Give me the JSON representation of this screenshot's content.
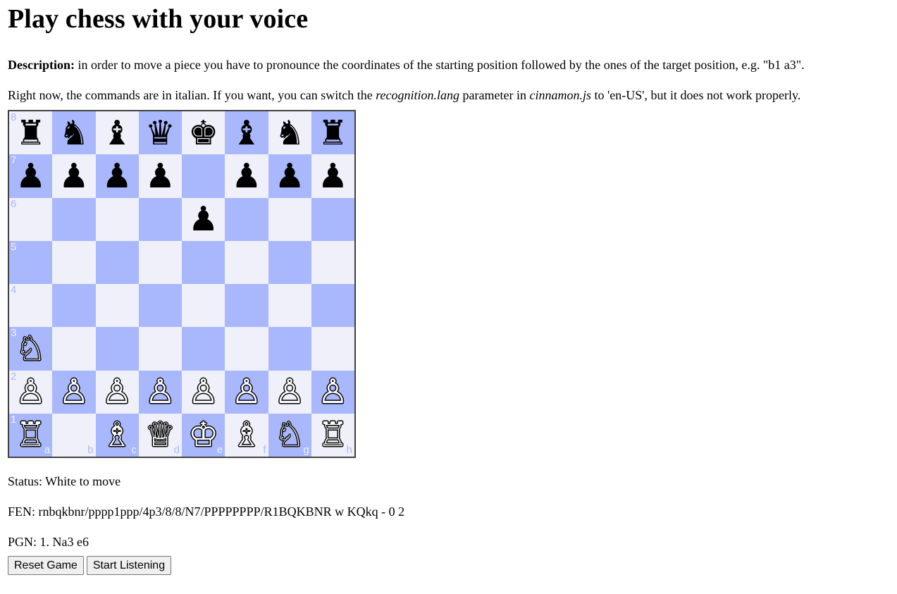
{
  "page": {
    "title": "Play chess with your voice",
    "description_label": "Description:",
    "description_text": " in order to move a piece you have to pronounce the coordinates of the starting position followed by the ones of the target position, e.g. \"b1 a3\".",
    "note_part1": "Right now, the commands are in italian. If you want, you can switch the ",
    "note_em1": "recognition.lang",
    "note_part2": " parameter in ",
    "note_em2": "cinnamon.js",
    "note_part3": " to 'en-US', but it does not work properly."
  },
  "board": {
    "rows": [
      [
        "♜",
        "♞",
        "♝",
        "♛",
        "♚",
        "♝",
        "♞",
        "♜"
      ],
      [
        "♟",
        "♟",
        "♟",
        "♟",
        "",
        "♟",
        "♟",
        "♟"
      ],
      [
        "",
        "",
        "",
        "",
        "♟",
        "",
        "",
        ""
      ],
      [
        "",
        "",
        "",
        "",
        "",
        "",
        "",
        ""
      ],
      [
        "",
        "",
        "",
        "",
        "",
        "",
        "",
        ""
      ],
      [
        "♘",
        "",
        "",
        "",
        "",
        "",
        "",
        ""
      ],
      [
        "♙",
        "♙",
        "♙",
        "♙",
        "♙",
        "♙",
        "♙",
        "♙"
      ],
      [
        "♖",
        "",
        "♗",
        "♕",
        "♔",
        "♗",
        "♘",
        "♖"
      ]
    ],
    "colors": [
      [
        "b",
        "b",
        "b",
        "b",
        "b",
        "b",
        "b",
        "b"
      ],
      [
        "b",
        "b",
        "b",
        "b",
        "",
        "b",
        "b",
        "b"
      ],
      [
        "",
        "",
        "",
        "",
        "b",
        "",
        "",
        ""
      ],
      [
        "",
        "",
        "",
        "",
        "",
        "",
        "",
        ""
      ],
      [
        "",
        "",
        "",
        "",
        "",
        "",
        "",
        ""
      ],
      [
        "w",
        "",
        "",
        "",
        "",
        "",
        "",
        ""
      ],
      [
        "w",
        "w",
        "w",
        "w",
        "w",
        "w",
        "w",
        "w"
      ],
      [
        "w",
        "",
        "w",
        "w",
        "w",
        "w",
        "w",
        "w"
      ]
    ],
    "ranks": [
      "8",
      "7",
      "6",
      "5",
      "4",
      "3",
      "2",
      "1"
    ],
    "files": [
      "a",
      "b",
      "c",
      "d",
      "e",
      "f",
      "g",
      "h"
    ],
    "light_color": "#f0f0fb",
    "dark_color": "#a9b8fd"
  },
  "status": "Status: White to move",
  "fen": "FEN: rnbqkbnr/pppp1ppp/4p3/8/8/N7/PPPPPPPP/R1BQKBNR w KQkq - 0 2",
  "pgn": "PGN: 1. Na3 e6",
  "buttons": {
    "reset_label": "Reset Game",
    "listen_label": "Start Listening"
  }
}
